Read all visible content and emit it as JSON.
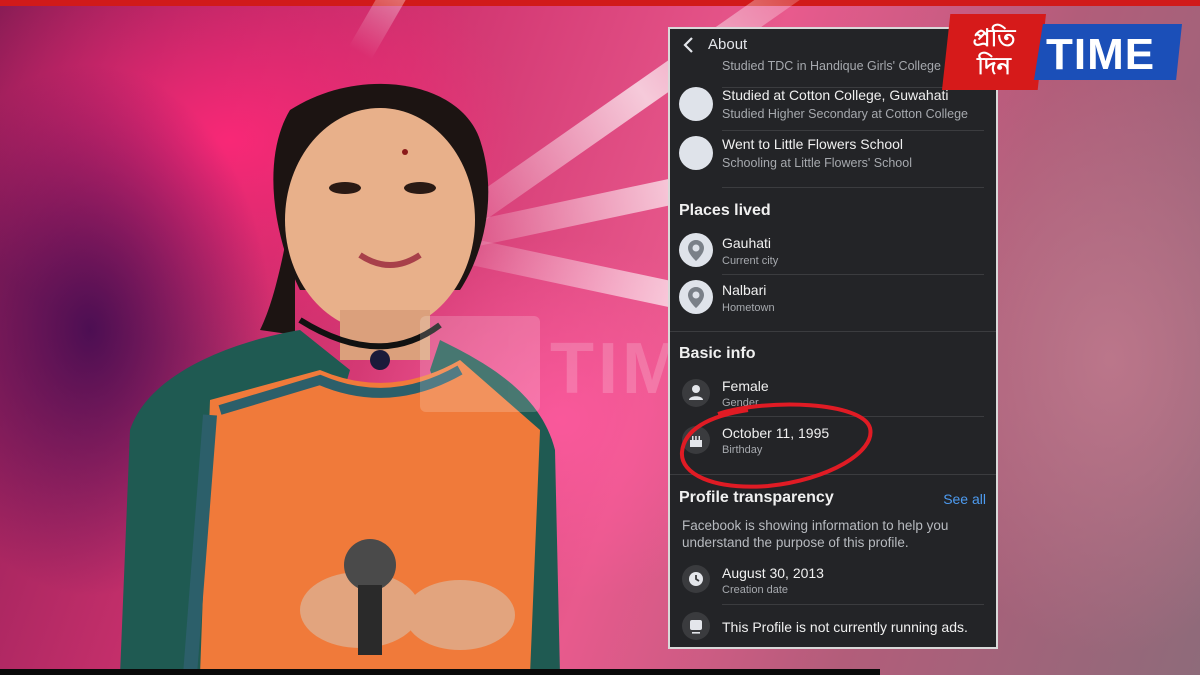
{
  "header": {
    "title": "About"
  },
  "education": [
    {
      "title": "",
      "subtitle": "Studied TDC in Handique Girls' College"
    },
    {
      "title": "Studied at Cotton College, Guwahati",
      "subtitle": "Studied Higher Secondary at Cotton College"
    },
    {
      "title": "Went to Little Flowers School",
      "subtitle": "Schooling  at Little Flowers' School"
    }
  ],
  "places": {
    "heading": "Places lived",
    "items": [
      {
        "title": "Gauhati",
        "subtitle": "Current city"
      },
      {
        "title": "Nalbari",
        "subtitle": "Hometown"
      }
    ]
  },
  "basic": {
    "heading": "Basic info",
    "items": [
      {
        "title": "Female",
        "subtitle": "Gender"
      },
      {
        "title": "October 11, 1995",
        "subtitle": "Birthday"
      }
    ]
  },
  "transparency": {
    "heading": "Profile transparency",
    "see_all": "See all",
    "description": "Facebook is showing information to help you understand the purpose of this profile.",
    "creation": {
      "title": "August 30, 2013",
      "subtitle": "Creation date"
    },
    "ads": {
      "title": "This Profile is not currently running ads."
    }
  },
  "logo": {
    "left_text": "প্রতি দিন",
    "right_text": "TIME"
  },
  "colors": {
    "panel_bg": "#232427",
    "link_blue": "#4d9bf0",
    "highlight_red": "#e01b24",
    "logo_red": "#d61a1a",
    "logo_blue": "#1b4fb8"
  }
}
